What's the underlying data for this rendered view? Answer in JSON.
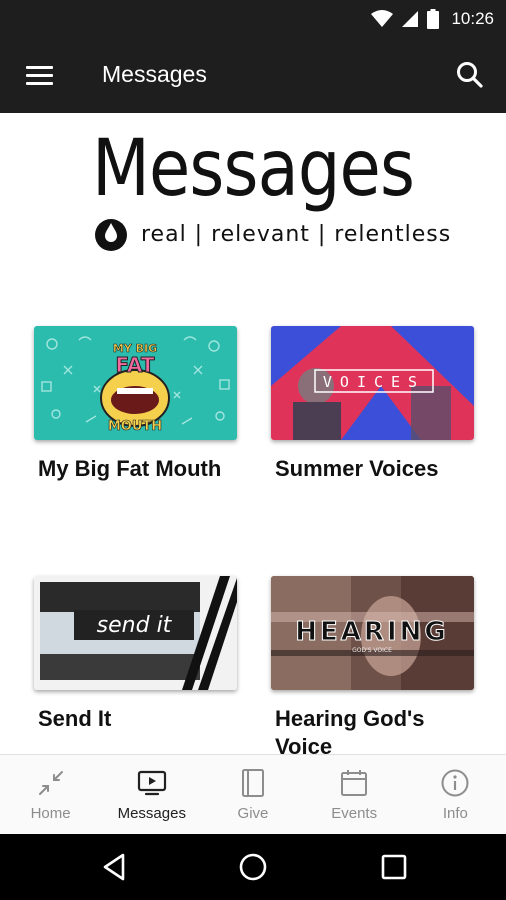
{
  "status_bar": {
    "time": "10:26",
    "icons": [
      "wifi-icon",
      "cell-signal-icon",
      "battery-icon"
    ]
  },
  "app_bar": {
    "title": "Messages",
    "menu_icon": "hamburger-menu-icon",
    "search_icon": "search-icon"
  },
  "header_logo": {
    "title": "Messages",
    "tagline": "real | relevant | relentless",
    "icon": "drop-icon"
  },
  "series": [
    {
      "title": "My Big Fat Mouth",
      "thumb_text": "MY BIG FAT MOUTH"
    },
    {
      "title": "Summer Voices",
      "thumb_text": "VOICES"
    },
    {
      "title": "Send It",
      "thumb_text": "send it"
    },
    {
      "title": "Hearing God's Voice",
      "thumb_text": "HEARING"
    }
  ],
  "bottom_nav": {
    "items": [
      {
        "label": "Home",
        "icon": "collapse-arrows-icon",
        "active": false
      },
      {
        "label": "Messages",
        "icon": "tv-play-icon",
        "active": true
      },
      {
        "label": "Give",
        "icon": "book-icon",
        "active": false
      },
      {
        "label": "Events",
        "icon": "calendar-icon",
        "active": false
      },
      {
        "label": "Info",
        "icon": "info-icon",
        "active": false
      }
    ]
  },
  "system_nav": [
    "back-icon",
    "home-circle-icon",
    "recents-icon"
  ],
  "colors": {
    "bar": "#1e1e1e",
    "nav_background": "#fafafa",
    "nav_inactive": "#8d8d8d",
    "nav_active": "#212121"
  }
}
